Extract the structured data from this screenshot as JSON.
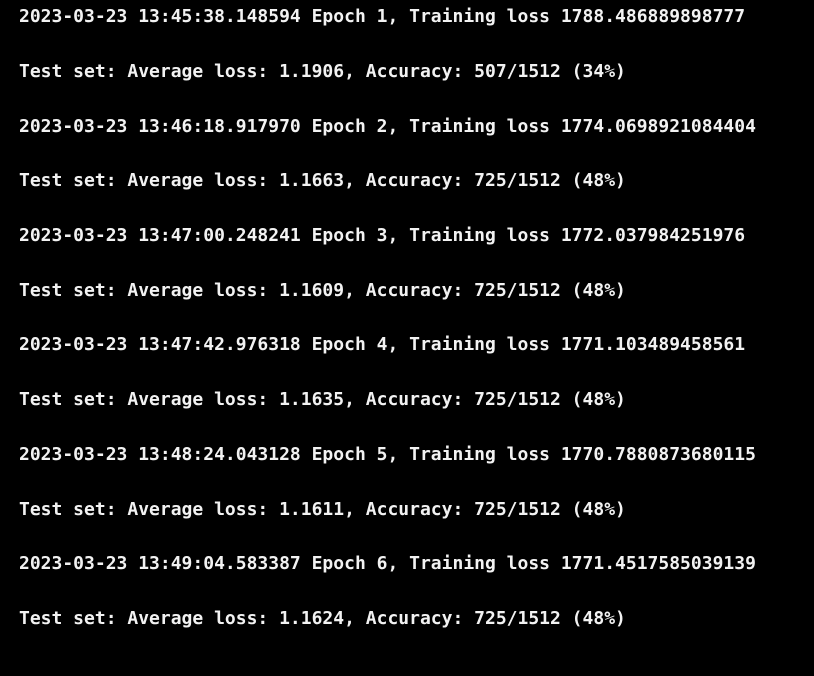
{
  "terminal": {
    "background": "#000000",
    "text_color": "#f2f2f2",
    "lines": [
      "2023-03-23 13:45:38.148594 Epoch 1, Training loss 1788.486889898777",
      "Test set: Average loss: 1.1906, Accuracy: 507/1512 (34%)",
      "2023-03-23 13:46:18.917970 Epoch 2, Training loss 1774.0698921084404",
      "Test set: Average loss: 1.1663, Accuracy: 725/1512 (48%)",
      "2023-03-23 13:47:00.248241 Epoch 3, Training loss 1772.037984251976",
      "Test set: Average loss: 1.1609, Accuracy: 725/1512 (48%)",
      "2023-03-23 13:47:42.976318 Epoch 4, Training loss 1771.103489458561",
      "Test set: Average loss: 1.1635, Accuracy: 725/1512 (48%)",
      "2023-03-23 13:48:24.043128 Epoch 5, Training loss 1770.7880873680115",
      "Test set: Average loss: 1.1611, Accuracy: 725/1512 (48%)",
      "2023-03-23 13:49:04.583387 Epoch 6, Training loss 1771.4517585039139",
      "Test set: Average loss: 1.1624, Accuracy: 725/1512 (48%)"
    ]
  }
}
